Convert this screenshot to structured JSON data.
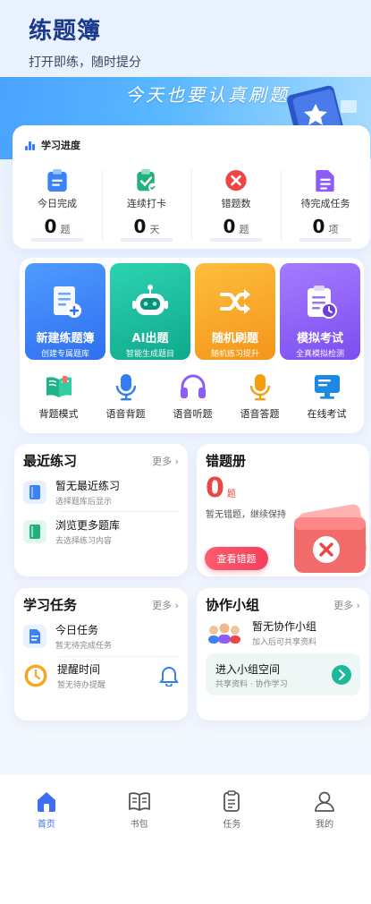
{
  "header": {
    "title": "练题簿",
    "subtitle": "打开即练，随时提分"
  },
  "banner": {
    "slogan": "今天也要认真刷题"
  },
  "progress": {
    "title": "学习进度",
    "stats": [
      {
        "label": "今日完成",
        "value": "0",
        "unit": "题",
        "icon": "clipboard-icon",
        "color": "#3b82f6"
      },
      {
        "label": "连续打卡",
        "value": "0",
        "unit": "天",
        "icon": "checkin-icon",
        "color": "#22b07d"
      },
      {
        "label": "错题数",
        "value": "0",
        "unit": "题",
        "icon": "error-icon",
        "color": "#ef4444"
      },
      {
        "label": "待完成任务",
        "value": "0",
        "unit": "项",
        "icon": "task-icon",
        "color": "#8b5cf6"
      }
    ]
  },
  "tiles": [
    {
      "title": "新建练题簿",
      "subtitle": "创建专属题库",
      "color": "#2f7ef5",
      "icon": "new-book-icon"
    },
    {
      "title": "AI出题",
      "subtitle": "智能生成题目",
      "color": "#14b89a",
      "icon": "robot-icon"
    },
    {
      "title": "随机刷题",
      "subtitle": "随机练习提升",
      "color": "#f7a823",
      "icon": "shuffle-icon"
    },
    {
      "title": "模拟考试",
      "subtitle": "全真模拟检测",
      "color": "#8a5cf0",
      "icon": "exam-icon"
    }
  ],
  "quick": [
    {
      "label": "背题模式",
      "icon": "open-book-icon"
    },
    {
      "label": "语音背题",
      "icon": "microphone-icon"
    },
    {
      "label": "语音听题",
      "icon": "headphones-icon"
    },
    {
      "label": "语音答题",
      "icon": "microphone-orange-icon"
    },
    {
      "label": "在线考试",
      "icon": "monitor-icon"
    }
  ],
  "recent": {
    "title": "最近练习",
    "more": "更多 ›",
    "items": [
      {
        "title": "暂无最近练习",
        "subtitle": "选择题库后显示"
      },
      {
        "title": "浏览更多题库",
        "subtitle": "去选择练习内容"
      }
    ]
  },
  "wrongbook": {
    "title": "错题册",
    "count": "0",
    "unit": "题",
    "message": "暂无错题，继续保持",
    "button": "查看错题"
  },
  "tasks": {
    "title": "学习任务",
    "more": "更多 ›",
    "items": [
      {
        "title": "今日任务",
        "subtitle": "暂无待完成任务"
      },
      {
        "title": "提醒时间",
        "subtitle": "暂无待办提醒"
      }
    ]
  },
  "group": {
    "title": "协作小组",
    "more": "更多 ›",
    "empty_title": "暂无协作小组",
    "empty_sub": "加入后可共享资料",
    "join_title": "进入小组空间",
    "join_sub": "共享资料 · 协作学习"
  },
  "nav": [
    {
      "label": "首页",
      "icon": "home-icon",
      "active": true
    },
    {
      "label": "书包",
      "icon": "book-icon",
      "active": false
    },
    {
      "label": "任务",
      "icon": "task-clipboard-icon",
      "active": false
    },
    {
      "label": "我的",
      "icon": "user-icon",
      "active": false
    }
  ]
}
